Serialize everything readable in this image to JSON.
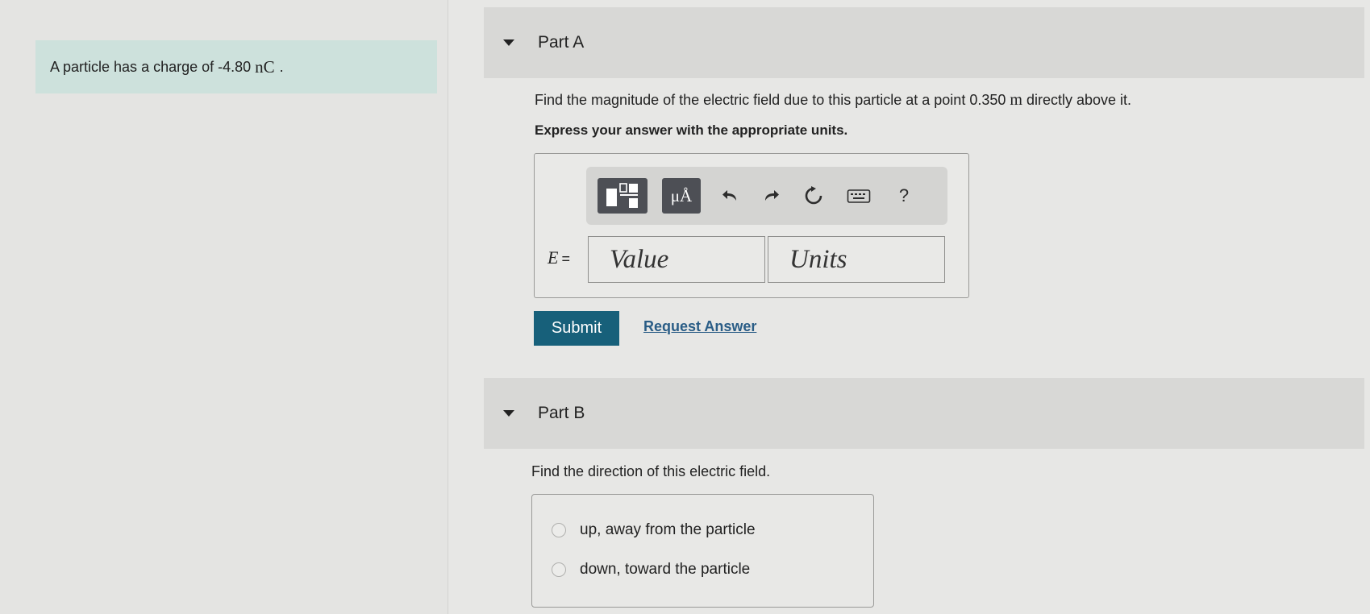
{
  "problem": {
    "text": "A particle has a charge of -4.80",
    "unit": "nC",
    "suffix": "."
  },
  "part_a": {
    "title": "Part A",
    "question_before": "Find the magnitude of the electric field due to this particle at a point 0.350",
    "question_unit": "m",
    "question_after": "directly above it.",
    "instruction": "Express your answer with the appropriate units.",
    "toolbar": {
      "units_button": "μÅ",
      "help": "?"
    },
    "equation_label": "E",
    "equation_sign": "=",
    "value_placeholder": "Value",
    "units_placeholder": "Units",
    "submit_label": "Submit",
    "request_answer_label": "Request Answer"
  },
  "part_b": {
    "title": "Part B",
    "question": "Find the direction of this electric field.",
    "choices": [
      {
        "label": "up, away from the particle",
        "selected": false
      },
      {
        "label": "down, toward the particle",
        "selected": false
      }
    ]
  },
  "colors": {
    "problem_background": "#cde1dc",
    "submit_background": "#17607a",
    "link": "#2a5d86",
    "header_background": "#d8d8d6"
  }
}
